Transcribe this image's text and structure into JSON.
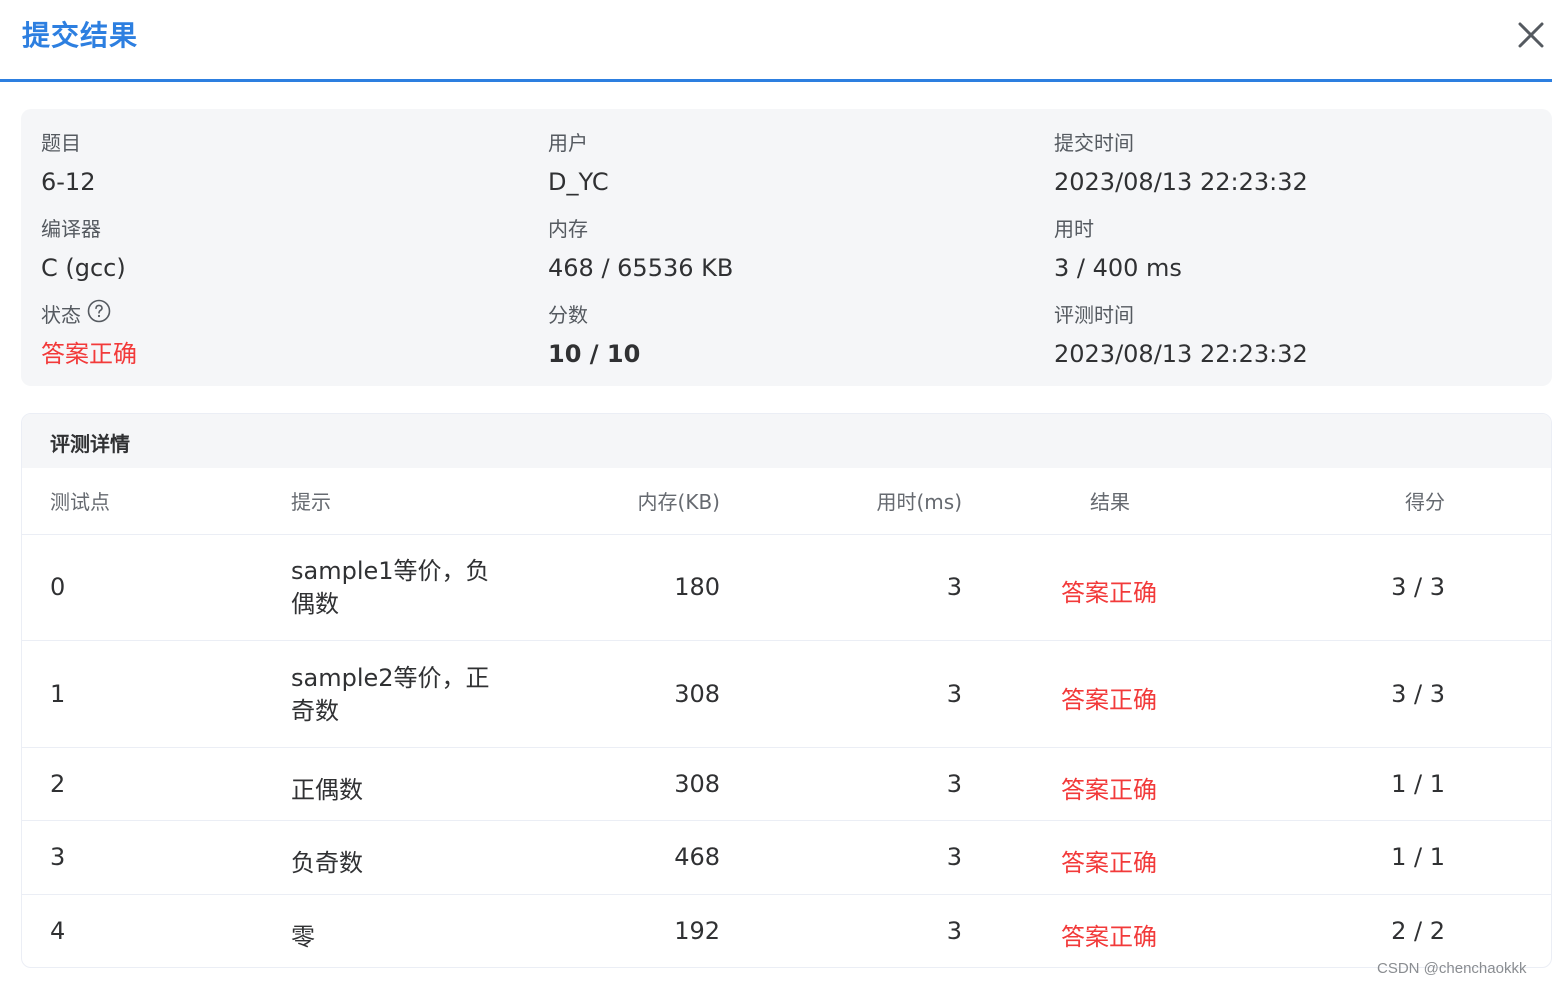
{
  "header": {
    "title": "提交结果"
  },
  "info": {
    "problem_label": "题目",
    "problem_value": "6-12",
    "user_label": "用户",
    "user_value": "D_YC",
    "submit_time_label": "提交时间",
    "submit_time_value": "2023/08/13 22:23:32",
    "compiler_label": "编译器",
    "compiler_value": "C (gcc)",
    "memory_label": "内存",
    "memory_value": "468 / 65536 KB",
    "time_label": "用时",
    "time_value": "3 / 400 ms",
    "status_label": "状态",
    "status_value": "答案正确",
    "score_label": "分数",
    "score_value": "10 / 10",
    "judge_time_label": "评测时间",
    "judge_time_value": "2023/08/13 22:23:32"
  },
  "details": {
    "title": "评测详情",
    "columns": [
      "测试点",
      "提示",
      "内存(KB)",
      "用时(ms)",
      "结果",
      "得分"
    ],
    "rows": [
      {
        "id": "0",
        "hint": "sample1等价，负偶数",
        "memory": "180",
        "time": "3",
        "result": "答案正确",
        "score": "3 / 3"
      },
      {
        "id": "1",
        "hint": "sample2等价，正奇数",
        "memory": "308",
        "time": "3",
        "result": "答案正确",
        "score": "3 / 3"
      },
      {
        "id": "2",
        "hint": "正偶数",
        "memory": "308",
        "time": "3",
        "result": "答案正确",
        "score": "1 / 1"
      },
      {
        "id": "3",
        "hint": "负奇数",
        "memory": "468",
        "time": "3",
        "result": "答案正确",
        "score": "1 / 1"
      },
      {
        "id": "4",
        "hint": "零",
        "memory": "192",
        "time": "3",
        "result": "答案正确",
        "score": "2 / 2"
      }
    ]
  },
  "watermark": "CSDN @chenchaokkk",
  "colors": {
    "accent": "#2d7fe0",
    "success_red": "#f23a3a"
  }
}
